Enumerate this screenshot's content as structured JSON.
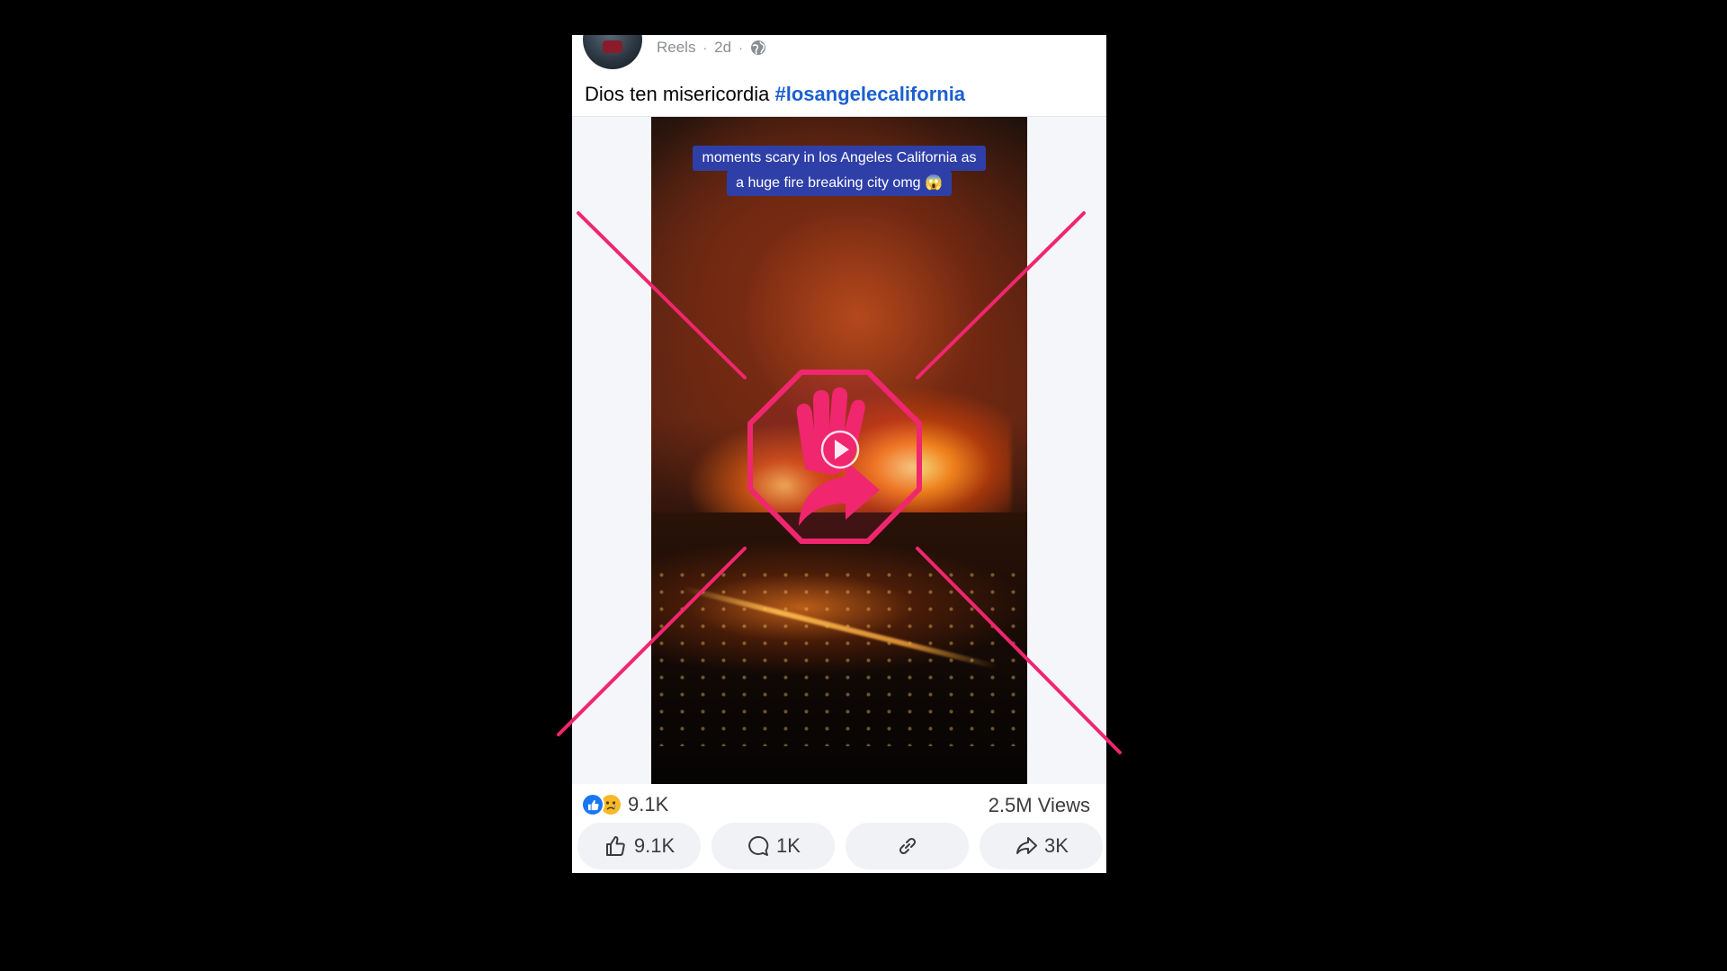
{
  "post": {
    "source": "Reels",
    "age": "2d",
    "separator": "·",
    "caption_text": "Dios ten misericordia ",
    "caption_hashtag": "#losangelecalifornia"
  },
  "video": {
    "banner_line1": "moments scary in los Angeles California as",
    "banner_line2": "a huge fire breaking city  omg 😱"
  },
  "stats": {
    "reaction_count": "9.1K",
    "views": "2.5M Views"
  },
  "actions": {
    "like_count": "9.1K",
    "comment_count": "1K",
    "share_count": "3K"
  },
  "colors": {
    "overlay_pink": "#f0266f",
    "hashtag_blue": "#1b5fcf",
    "like_blue": "#1877f2"
  },
  "icons": {
    "overlay": "stop-sharing-icon",
    "privacy": "globe-icon"
  }
}
